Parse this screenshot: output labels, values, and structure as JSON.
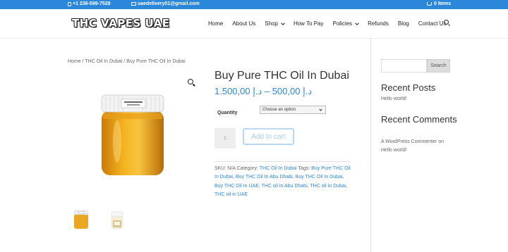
{
  "topbar": {
    "phone": "+1 236-599-7528",
    "email": "uaedelivery01@gmail.com",
    "cart": "0 Items",
    "bg_color": "#2b87da"
  },
  "header": {
    "logo": "THC VAPES UAE",
    "nav": [
      {
        "label": "Home",
        "dropdown": false
      },
      {
        "label": "About Us",
        "dropdown": false
      },
      {
        "label": "Shop",
        "dropdown": true
      },
      {
        "label": "How To Pay",
        "dropdown": false
      },
      {
        "label": "Policies",
        "dropdown": true
      },
      {
        "label": "Refunds",
        "dropdown": false
      },
      {
        "label": "Blog",
        "dropdown": false
      },
      {
        "label": "Contact Us",
        "dropdown": false
      }
    ],
    "search_icon": "search-icon"
  },
  "breadcrumb": "Home / THC Oil In Dubai / Buy Pure THC Oil In Dubai",
  "product": {
    "title": "Buy Pure THC Oil In Dubai",
    "price": "د.إ 500,00 – د.إ 1.500,00",
    "quantity_label": "Quantity",
    "select_value": "Choose an option",
    "qty_value": "1",
    "add_to_cart": "Add to cart",
    "accent_color": "#2b87da",
    "meta": {
      "sku_label": "SKU:",
      "sku_value": "N/A",
      "category_label": "Category:",
      "category": "THC Oil In Dubai",
      "tags_label": "Tags:",
      "tags": [
        "Buy Pure THC Oil In Dubai",
        "Buy THC Oil In Abu Dhabi",
        "Buy THC Oil In Dubai",
        "Buy THC Oil In UAE",
        "THC oil in Abu Dhabi",
        "THC oil in Dubai",
        "THC oil in UAE"
      ]
    }
  },
  "sidebar": {
    "search_button": "Search",
    "recent_posts_title": "Recent Posts",
    "recent_post": "Hello world!",
    "recent_comments_title": "Recent Comments",
    "comment_author": "A WordPress Commenter",
    "comment_on": "on",
    "comment_post": "Hello world!"
  }
}
